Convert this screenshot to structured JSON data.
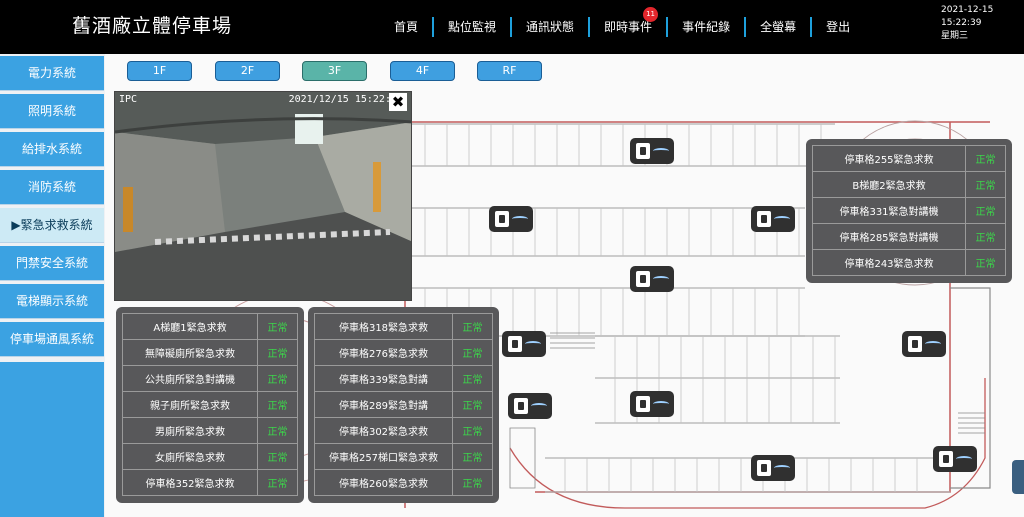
{
  "header": {
    "title": "舊酒廠立體停車場",
    "nav": [
      {
        "label": "首頁"
      },
      {
        "label": "點位監視"
      },
      {
        "label": "通訊狀態"
      },
      {
        "label": "即時事件",
        "badge": "11"
      },
      {
        "label": "事件紀錄"
      },
      {
        "label": "全螢幕"
      },
      {
        "label": "登出"
      }
    ],
    "clock": {
      "date": "2021-12-15",
      "time": "15:22:39",
      "weekday": "星期三"
    }
  },
  "sidebar": {
    "items": [
      {
        "label": "電力系統"
      },
      {
        "label": "照明系統"
      },
      {
        "label": "給排水系統"
      },
      {
        "label": "消防系統"
      },
      {
        "label": "▶緊急求救系統"
      },
      {
        "label": "門禁安全系統"
      },
      {
        "label": "電梯顯示系統"
      },
      {
        "label": "停車場通風系統"
      }
    ],
    "active_index": 4
  },
  "floors": {
    "tabs": [
      "1F",
      "2F",
      "3F",
      "4F",
      "RF"
    ],
    "active_index": 2
  },
  "camera": {
    "label": "IPC",
    "timestamp": "2021/12/15 15:22:39"
  },
  "panels": {
    "left": [
      {
        "name": "A梯廳1緊急求救",
        "status": "正常"
      },
      {
        "name": "無障礙廁所緊急求救",
        "status": "正常"
      },
      {
        "name": "公共廁所緊急對講機",
        "status": "正常"
      },
      {
        "name": "親子廁所緊急求救",
        "status": "正常"
      },
      {
        "name": "男廁所緊急求救",
        "status": "正常"
      },
      {
        "name": "女廁所緊急求救",
        "status": "正常"
      },
      {
        "name": "停車格352緊急求救",
        "status": "正常"
      }
    ],
    "middle": [
      {
        "name": "停車格318緊急求救",
        "status": "正常"
      },
      {
        "name": "停車格276緊急求救",
        "status": "正常"
      },
      {
        "name": "停車格339緊急對講",
        "status": "正常"
      },
      {
        "name": "停車格289緊急對講",
        "status": "正常"
      },
      {
        "name": "停車格302緊急求救",
        "status": "正常"
      },
      {
        "name": "停車格257梯口緊急求救",
        "status": "正常"
      },
      {
        "name": "停車格260緊急求救",
        "status": "正常"
      }
    ],
    "right": [
      {
        "name": "停車格255緊急求救",
        "status": "正常"
      },
      {
        "name": "B梯廳2緊急求救",
        "status": "正常"
      },
      {
        "name": "停車格331緊急對講機",
        "status": "正常"
      },
      {
        "name": "停車格285緊急對講機",
        "status": "正常"
      },
      {
        "name": "停車格243緊急求救",
        "status": "正常"
      }
    ]
  },
  "colors": {
    "header_bg": "#000000",
    "sidebar_item": "#3ba2e2",
    "sidebar_active": "#cdeaf5",
    "status_ok": "#3bd84a",
    "panel_bg": "#58585a",
    "map_wall": "#c25b5b"
  }
}
